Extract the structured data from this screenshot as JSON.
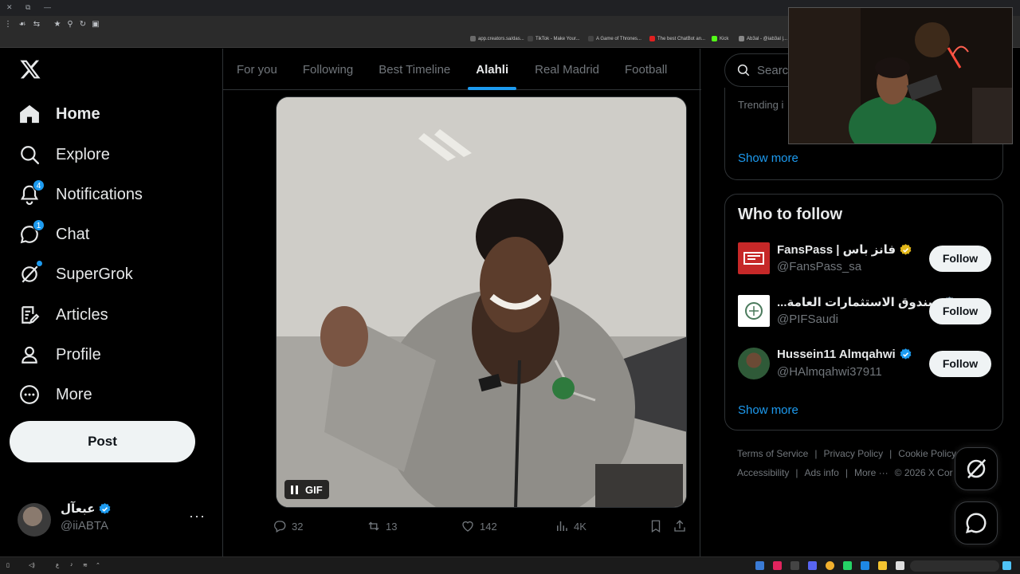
{
  "browser": {
    "bookmarks": [
      {
        "label": "app.creators.sa/das...",
        "color": "#6b6b6b"
      },
      {
        "label": "TikTok - Make Your...",
        "color": "#222222"
      },
      {
        "label": "A Game of Thrones...",
        "color": "#444444"
      },
      {
        "label": "The best ChatBot an...",
        "color": "#e02020"
      },
      {
        "label": "Kick",
        "color": "#53fc18"
      },
      {
        "label": "Ab3al - @iab3al |...",
        "color": "#888888"
      }
    ]
  },
  "leftnav": {
    "items": [
      {
        "label": "Home",
        "icon": "home-icon",
        "active": true
      },
      {
        "label": "Explore",
        "icon": "search-icon"
      },
      {
        "label": "Notifications",
        "icon": "bell-icon",
        "badge": "4"
      },
      {
        "label": "Chat",
        "icon": "chat-icon",
        "badge": "1"
      },
      {
        "label": "SuperGrok",
        "icon": "grok-icon",
        "dot": true
      },
      {
        "label": "Articles",
        "icon": "articles-icon"
      },
      {
        "label": "Profile",
        "icon": "profile-icon"
      },
      {
        "label": "More",
        "icon": "more-circle-icon"
      }
    ],
    "post_label": "Post",
    "account": {
      "name": "عبعآل",
      "handle": "@iiABTA"
    }
  },
  "timeline": {
    "tabs": [
      {
        "label": "For you"
      },
      {
        "label": "Following"
      },
      {
        "label": "Best Timeline"
      },
      {
        "label": "Alahli",
        "active": true
      },
      {
        "label": "Real Madrid"
      },
      {
        "label": "Football"
      }
    ],
    "post": {
      "media_badge": "GIF",
      "replies": "32",
      "reposts": "13",
      "likes": "142",
      "views": "4K"
    }
  },
  "sidebar": {
    "search_placeholder": "Search",
    "trending_label": "Trending i",
    "show_more": "Show more",
    "who_to_follow": {
      "title": "Who to follow",
      "follow_label": "Follow",
      "accounts": [
        {
          "name": "FansPass | فانز باس",
          "handle": "@FansPass_sa",
          "verified_color": "#e2b719"
        },
        {
          "name": "...صندوق الاستثمارات العامة",
          "handle": "@PIFSaudi",
          "verified_color": "#829aab"
        },
        {
          "name": "Hussein11 Almqahwi",
          "handle": "@HAlmqahwi37911",
          "verified_color": "#1d9bf0"
        }
      ],
      "show_more": "Show more"
    },
    "footer": {
      "line1": [
        "Terms of Service",
        "Privacy Policy",
        "Cookie Policy"
      ],
      "line2": [
        "Accessibility",
        "Ads info",
        "More ···",
        "© 2026 X Cor"
      ]
    }
  },
  "colors": {
    "accent": "#1d9bf0",
    "background": "#000000",
    "border": "#2f3336",
    "muted": "#71767b"
  }
}
